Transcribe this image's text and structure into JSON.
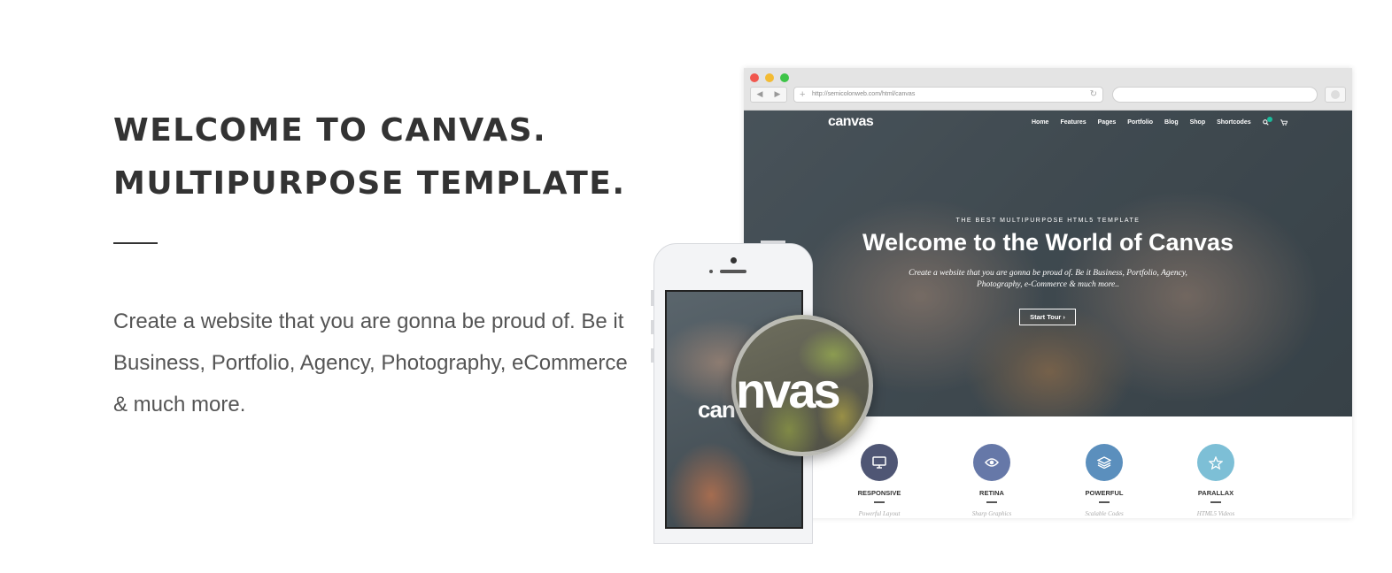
{
  "hero": {
    "title_line1": "WELCOME TO CANVAS.",
    "title_line2": "MULTIPURPOSE TEMPLATE.",
    "description": "Create a website that you are gonna be proud of. Be it Business, Portfolio, Agency, Photography, eCommerce & much more."
  },
  "browser": {
    "url": "http://semicolonweb.com/html/canvas",
    "site": {
      "logo": "canvas",
      "nav": [
        "Home",
        "Features",
        "Pages",
        "Portfolio",
        "Blog",
        "Shop",
        "Shortcodes"
      ],
      "eyebrow": "THE BEST MULTIPURPOSE HTML5 TEMPLATE",
      "headline": "Welcome to the World of Canvas",
      "subtext": "Create a website that you are gonna be proud of. Be it Business, Portfolio, Agency, Photography, e-Commerce & much more..",
      "cta": "Start Tour ›",
      "features": [
        {
          "title": "RESPONSIVE",
          "subtitle": "Powerful Layout",
          "icon": "monitor-icon",
          "color": "#4f5674"
        },
        {
          "title": "RETINA",
          "subtitle": "Sharp Graphics",
          "icon": "eye-icon",
          "color": "#6678a8"
        },
        {
          "title": "POWERFUL",
          "subtitle": "Scalable Codes",
          "icon": "layers-icon",
          "color": "#5b8fbd"
        },
        {
          "title": "PARALLAX",
          "subtitle": "HTML5 Videos",
          "icon": "star-icon",
          "color": "#7dbfd6"
        }
      ]
    }
  },
  "phone": {
    "logo": "canvas",
    "magnified_logo": "nvas"
  }
}
